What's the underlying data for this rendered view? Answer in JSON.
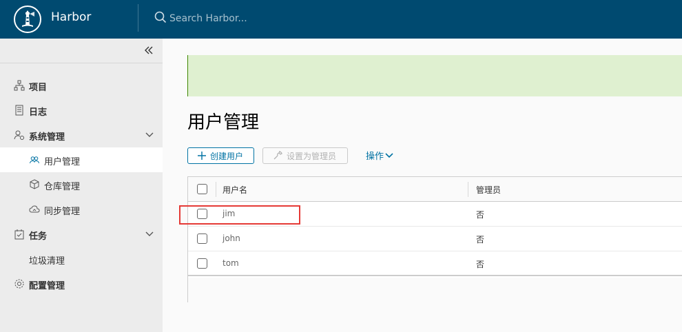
{
  "app": {
    "brand": "Harbor"
  },
  "search": {
    "placeholder": "Search Harbor..."
  },
  "sidebar": {
    "items": [
      {
        "label": "项目",
        "icon": "projects-icon"
      },
      {
        "label": "日志",
        "icon": "logs-icon"
      },
      {
        "label": "系统管理",
        "icon": "system-admin-icon",
        "expanded": true
      },
      {
        "label": "用户管理",
        "icon": "users-icon",
        "active": true
      },
      {
        "label": "仓库管理",
        "icon": "registries-icon"
      },
      {
        "label": "同步管理",
        "icon": "replication-icon"
      },
      {
        "label": "任务",
        "icon": "tasks-icon",
        "expanded": true
      },
      {
        "label": "垃圾清理"
      },
      {
        "label": "配置管理",
        "icon": "gear-icon"
      }
    ]
  },
  "page": {
    "title": "用户管理",
    "toolbar": {
      "new_user": "创建用户",
      "set_admin": "设置为管理员",
      "actions": "操作"
    },
    "table": {
      "columns": [
        "用户名",
        "管理员"
      ],
      "rows": [
        {
          "username": "jim",
          "admin": "否"
        },
        {
          "username": "john",
          "admin": "否"
        },
        {
          "username": "tom",
          "admin": "否"
        }
      ]
    }
  },
  "colors": {
    "header_bg": "#004a70",
    "accent": "#0072a3",
    "banner_bg": "#dff0d0",
    "highlight": "#e53935"
  }
}
